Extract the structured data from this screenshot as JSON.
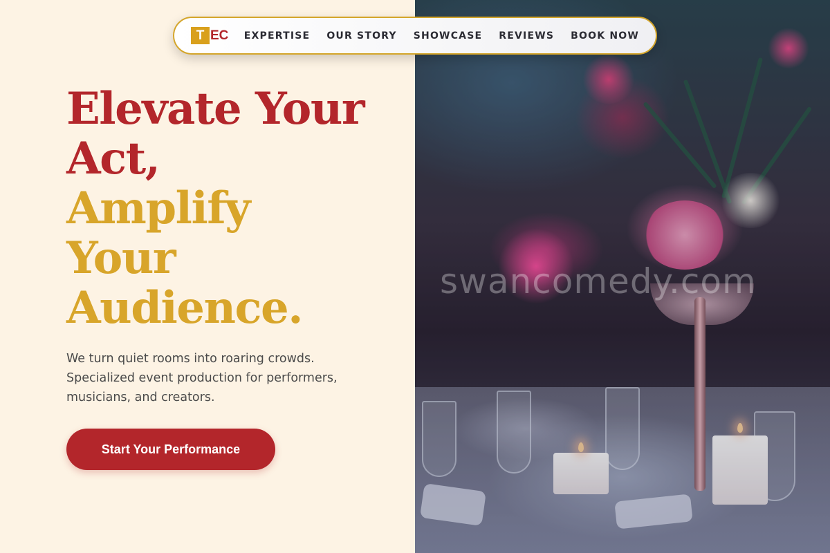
{
  "brand": {
    "logo_box": "T",
    "logo_rest": "EC"
  },
  "nav": {
    "items": [
      "EXPERTISE",
      "OUR STORY",
      "SHOWCASE",
      "REVIEWS",
      "BOOK NOW"
    ]
  },
  "hero": {
    "title_lines": [
      {
        "text": "Elevate Your",
        "color": "red"
      },
      {
        "text": "Act,",
        "color": "red"
      },
      {
        "text": "Amplify",
        "color": "gold"
      },
      {
        "text": "Your",
        "color": "gold"
      },
      {
        "text": "Audience.",
        "color": "gold"
      }
    ],
    "subtitle_lines": [
      "We turn quiet rooms into roaring crowds.",
      "Specialized event production for performers,",
      "musicians, and creators."
    ],
    "cta_label": "Start Your Performance"
  },
  "photo": {
    "watermark": "swancomedy.com"
  },
  "colors": {
    "red": "#b3262b",
    "gold": "#d8a52a",
    "cream": "#fdf3e4",
    "nav_border": "#d4a52a"
  }
}
